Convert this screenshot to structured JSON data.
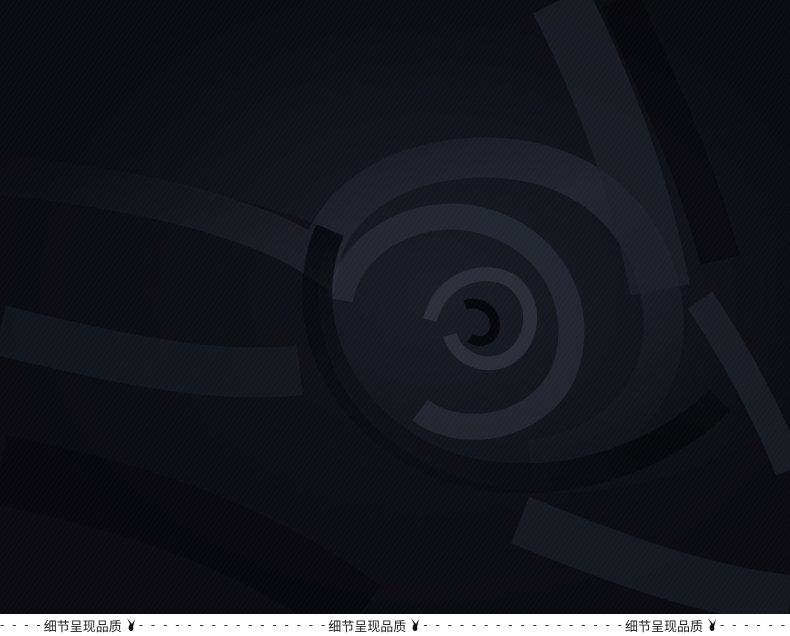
{
  "image": {
    "subject": "draped black twill fabric swirl",
    "colors": {
      "fabric_dark": "#0d0f15",
      "fabric_mid": "#1d2029",
      "fabric_highlight": "#3a3e4a",
      "background": "#ffffff"
    }
  },
  "footer": {
    "captions": [
      {
        "text": "细节呈现品质"
      },
      {
        "text": "细节呈现品质"
      },
      {
        "text": "细节呈现品质"
      }
    ],
    "dashes_left": "- - - -",
    "dashes_mid_1": "- - - - - - - - - - - - - - - -",
    "dashes_mid_2": "- - - - - - - - - - - - - - - - -",
    "dashes_right": "- - - - - -",
    "logo_icon": "bunny-logo-icon"
  }
}
